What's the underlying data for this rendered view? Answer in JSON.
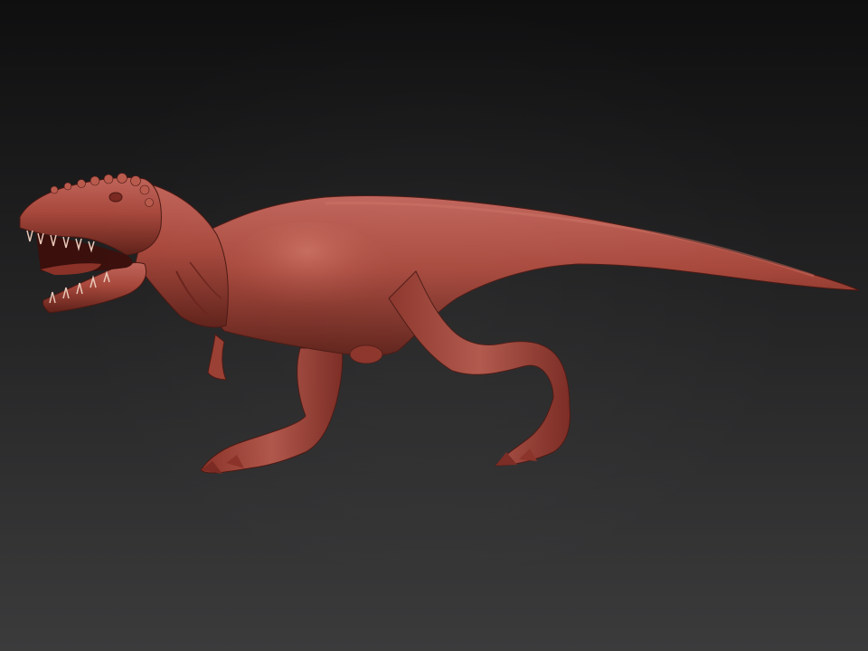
{
  "scene": {
    "background_top": "#0f0f10",
    "background_bottom": "#3b3b3c",
    "model_color": "#a8483c",
    "model_highlight": "#c8685a",
    "model_shadow": "#5a1e18",
    "subject_icon": "t-rex-sculpt"
  }
}
